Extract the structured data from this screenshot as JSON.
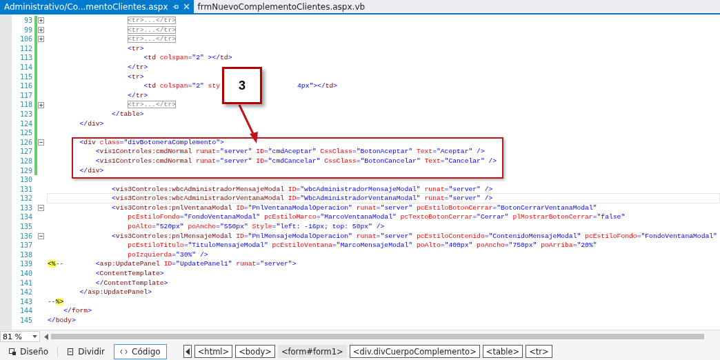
{
  "tabs": [
    {
      "label": "Administrativo/Co...mentoClientes.aspx",
      "selected": true
    },
    {
      "label": "frmNuevoComplementoClientes.aspx.vb",
      "selected": false
    }
  ],
  "callout": {
    "label": "3"
  },
  "lines": [
    {
      "num": "93",
      "changed": true,
      "current": false,
      "expanded": false,
      "tokens": [
        {
          "kind": "collapsed",
          "text": "                    <tr>...</tr>"
        }
      ]
    },
    {
      "num": "99",
      "changed": true,
      "current": false,
      "expanded": false,
      "tokens": [
        {
          "kind": "collapsed",
          "text": "                    <tr>...</tr>"
        }
      ]
    },
    {
      "num": "106",
      "changed": true,
      "current": false,
      "expanded": false,
      "tokens": [
        {
          "kind": "collapsed",
          "text": "                    <tr>...</tr>"
        }
      ]
    },
    {
      "num": "112",
      "changed": true,
      "current": false,
      "tokens": [
        {
          "kind": "delim",
          "text": "                    <"
        },
        {
          "kind": "element",
          "text": "tr"
        },
        {
          "kind": "delim",
          "text": ">"
        }
      ]
    },
    {
      "num": "113",
      "changed": true,
      "current": false,
      "tokens": [
        {
          "kind": "delim",
          "text": "                        <"
        },
        {
          "kind": "element",
          "text": "td"
        },
        {
          "kind": "attr",
          "text": " colspan"
        },
        {
          "kind": "value",
          "text": "=\"2\""
        },
        {
          "kind": "delim",
          "text": " ></"
        },
        {
          "kind": "element",
          "text": "td"
        },
        {
          "kind": "delim",
          "text": ">"
        }
      ]
    },
    {
      "num": "114",
      "changed": true,
      "current": false,
      "tokens": [
        {
          "kind": "delim",
          "text": "                    </"
        },
        {
          "kind": "element",
          "text": "tr"
        },
        {
          "kind": "delim",
          "text": ">"
        }
      ]
    },
    {
      "num": "115",
      "changed": true,
      "current": false,
      "tokens": [
        {
          "kind": "delim",
          "text": "                    <"
        },
        {
          "kind": "element",
          "text": "tr"
        },
        {
          "kind": "delim",
          "text": ">"
        }
      ]
    },
    {
      "num": "116",
      "changed": true,
      "current": false,
      "tokens": [
        {
          "kind": "delim",
          "text": "                        <"
        },
        {
          "kind": "element",
          "text": "td"
        },
        {
          "kind": "attr",
          "text": " colspan"
        },
        {
          "kind": "value",
          "text": "=\"2\""
        },
        {
          "kind": "attr",
          "text": " sty"
        }
      ],
      "after_callout": [
        {
          "kind": "value",
          "text": "4px\""
        },
        {
          "kind": "delim",
          "text": "></"
        },
        {
          "kind": "element",
          "text": "td"
        },
        {
          "kind": "delim",
          "text": ">"
        }
      ]
    },
    {
      "num": "117",
      "changed": true,
      "current": false,
      "tokens": [
        {
          "kind": "delim",
          "text": "                    </"
        },
        {
          "kind": "element",
          "text": "tr"
        },
        {
          "kind": "delim",
          "text": ">"
        }
      ]
    },
    {
      "num": "118",
      "changed": true,
      "current": false,
      "expanded": false,
      "tokens": [
        {
          "kind": "collapsed",
          "text": "                    <tr>...</tr>"
        }
      ]
    },
    {
      "num": "123",
      "changed": true,
      "current": false,
      "tokens": [
        {
          "kind": "delim",
          "text": "                </"
        },
        {
          "kind": "element",
          "text": "table"
        },
        {
          "kind": "delim",
          "text": ">"
        }
      ]
    },
    {
      "num": "124",
      "changed": true,
      "current": false,
      "tokens": [
        {
          "kind": "delim",
          "text": "        </"
        },
        {
          "kind": "element",
          "text": "div"
        },
        {
          "kind": "delim",
          "text": ">"
        }
      ]
    },
    {
      "num": "125",
      "changed": true,
      "current": false
    },
    {
      "num": "126",
      "changed": true,
      "current": false,
      "expanded": true,
      "tokens": [
        {
          "kind": "delim",
          "text": "        <"
        },
        {
          "kind": "element",
          "text": "div"
        },
        {
          "kind": "attr",
          "text": " class"
        },
        {
          "kind": "value",
          "text": "=\"divBotoneraComplemento\">"
        }
      ]
    },
    {
      "num": "127",
      "changed": true,
      "current": false,
      "tokens": [
        {
          "kind": "delim",
          "text": "            <"
        },
        {
          "kind": "element",
          "text": "vis1Controles:cmdNormal"
        },
        {
          "kind": "attr",
          "text": " runat"
        },
        {
          "kind": "value",
          "text": "=\"server\""
        },
        {
          "kind": "attr",
          "text": " ID"
        },
        {
          "kind": "value",
          "text": "=\"cmdAceptar\""
        },
        {
          "kind": "attr",
          "text": " CssClass"
        },
        {
          "kind": "value",
          "text": "=\"BotonAceptar\""
        },
        {
          "kind": "attr",
          "text": " Text"
        },
        {
          "kind": "value",
          "text": "=\"Aceptar\" />"
        }
      ]
    },
    {
      "num": "128",
      "changed": true,
      "current": false,
      "tokens": [
        {
          "kind": "delim",
          "text": "            <"
        },
        {
          "kind": "element",
          "text": "vis1Controles:cmdNormal"
        },
        {
          "kind": "attr",
          "text": " runat"
        },
        {
          "kind": "value",
          "text": "=\"server\""
        },
        {
          "kind": "attr",
          "text": " ID"
        },
        {
          "kind": "value",
          "text": "=\"cmdCancelar\""
        },
        {
          "kind": "attr",
          "text": " CssClass"
        },
        {
          "kind": "value",
          "text": "=\"BotonCancelar\""
        },
        {
          "kind": "attr",
          "text": " Text"
        },
        {
          "kind": "value",
          "text": "=\"Cancelar\" />"
        }
      ]
    },
    {
      "num": "129",
      "changed": true,
      "current": false,
      "tokens": [
        {
          "kind": "delim",
          "text": "        </"
        },
        {
          "kind": "element",
          "text": "div"
        },
        {
          "kind": "delim",
          "text": ">"
        }
      ]
    },
    {
      "num": "130",
      "changed": false,
      "current": false
    },
    {
      "num": "131",
      "changed": false,
      "current": false,
      "tokens": [
        {
          "kind": "delim",
          "text": "                <"
        },
        {
          "kind": "element",
          "text": "vis3Controles:wbcAdministradorMensajeModal"
        },
        {
          "kind": "attr",
          "text": " ID"
        },
        {
          "kind": "value",
          "text": "=\"wbcAdministradorMensajeModal\""
        },
        {
          "kind": "attr",
          "text": " runat"
        },
        {
          "kind": "value",
          "text": "=\"server\" />"
        }
      ]
    },
    {
      "num": "132",
      "changed": false,
      "current": true,
      "tokens": [
        {
          "kind": "delim",
          "text": "                <"
        },
        {
          "kind": "element",
          "text": "vis3Controles:wbcAdministradorVentanaModal"
        },
        {
          "kind": "attr",
          "text": " ID"
        },
        {
          "kind": "value",
          "text": "=\"WbcAdministradorVentanaModal\""
        },
        {
          "kind": "attr",
          "text": " runat"
        },
        {
          "kind": "value",
          "text": "=\"server\" />"
        }
      ]
    },
    {
      "num": "133",
      "changed": false,
      "current": false,
      "expanded": true,
      "tokens": [
        {
          "kind": "delim",
          "text": "                <"
        },
        {
          "kind": "element",
          "text": "vis3Controles:pnlVentanaModal"
        },
        {
          "kind": "attr",
          "text": " ID"
        },
        {
          "kind": "value",
          "text": "=\"PnlVentanaModalOperacion\""
        },
        {
          "kind": "attr",
          "text": " runat"
        },
        {
          "kind": "value",
          "text": "=\"server\""
        },
        {
          "kind": "attr",
          "text": " pcEstiloBotonCerrar"
        },
        {
          "kind": "value",
          "text": "=\"BotonCerrarVentanaModal\""
        }
      ]
    },
    {
      "num": "134",
      "changed": false,
      "current": false,
      "tokens": [
        {
          "kind": "attr",
          "text": "                    pcEstiloFondo"
        },
        {
          "kind": "value",
          "text": "=\"FondoVentanaModal\""
        },
        {
          "kind": "attr",
          "text": " pcEstiloMarco"
        },
        {
          "kind": "value",
          "text": "=\"MarcoVentanaModal\""
        },
        {
          "kind": "attr",
          "text": " pcTextoBotonCerrar"
        },
        {
          "kind": "value",
          "text": "=\"Cerrar\""
        },
        {
          "kind": "attr",
          "text": " plMostrarBotonCerrar"
        },
        {
          "kind": "value",
          "text": "=\"false\""
        }
      ]
    },
    {
      "num": "135",
      "changed": false,
      "current": false,
      "tokens": [
        {
          "kind": "attr",
          "text": "                    poAlto"
        },
        {
          "kind": "value",
          "text": "=\"520px\""
        },
        {
          "kind": "attr",
          "text": " poAncho"
        },
        {
          "kind": "value",
          "text": "=\"550px\""
        },
        {
          "kind": "attr",
          "text": " Style"
        },
        {
          "kind": "value",
          "text": "=\"left: -16px; top: 50px\" />"
        }
      ]
    },
    {
      "num": "136",
      "changed": false,
      "current": false,
      "expanded": true,
      "tokens": [
        {
          "kind": "delim",
          "text": "                <"
        },
        {
          "kind": "element",
          "text": "vis3Controles:pnlMensajeModal"
        },
        {
          "kind": "attr",
          "text": " ID"
        },
        {
          "kind": "value",
          "text": "=\"PnlMensajeModalOperacion\""
        },
        {
          "kind": "attr",
          "text": " runat"
        },
        {
          "kind": "value",
          "text": "=\"server\""
        },
        {
          "kind": "attr",
          "text": " pcEstiloContenido"
        },
        {
          "kind": "value",
          "text": "=\"ContenidoMensajeModal\""
        },
        {
          "kind": "attr",
          "text": " pcEstiloFondo"
        },
        {
          "kind": "value",
          "text": "=\"FondoVentanaModal\""
        }
      ]
    },
    {
      "num": "137",
      "changed": false,
      "current": false,
      "tokens": [
        {
          "kind": "attr",
          "text": "                    pcEstiloTitulo"
        },
        {
          "kind": "value",
          "text": "=\"TituloMensajeModal\""
        },
        {
          "kind": "attr",
          "text": " pcEstiloVentana"
        },
        {
          "kind": "value",
          "text": "=\"MarcoMensajeModal\""
        },
        {
          "kind": "attr",
          "text": " poAlto"
        },
        {
          "kind": "value",
          "text": "=\"400px\""
        },
        {
          "kind": "attr",
          "text": " poAncho"
        },
        {
          "kind": "value",
          "text": "=\"750px\""
        },
        {
          "kind": "attr",
          "text": " poArriba"
        },
        {
          "kind": "value",
          "text": "=\"20%\""
        }
      ]
    },
    {
      "num": "138",
      "changed": false,
      "current": false,
      "tokens": [
        {
          "kind": "attr",
          "text": "                    poIzquierda"
        },
        {
          "kind": "value",
          "text": "=\"30%\" />"
        }
      ]
    },
    {
      "num": "139",
      "changed": false,
      "current": false,
      "tokens": [
        {
          "kind": "server",
          "text": "<%"
        },
        {
          "kind": "comment",
          "text": "--"
        },
        {
          "kind": "delim",
          "text": "        <"
        },
        {
          "kind": "element",
          "text": "asp:UpdatePanel"
        },
        {
          "kind": "attr",
          "text": " ID"
        },
        {
          "kind": "value",
          "text": "=\"UpdatePanel1\""
        },
        {
          "kind": "attr",
          "text": " runat"
        },
        {
          "kind": "value",
          "text": "=\"server\">"
        }
      ]
    },
    {
      "num": "140",
      "changed": false,
      "current": false,
      "tokens": [
        {
          "kind": "delim",
          "text": "            <"
        },
        {
          "kind": "element",
          "text": "ContentTemplate"
        },
        {
          "kind": "delim",
          "text": ">"
        }
      ]
    },
    {
      "num": "141",
      "changed": false,
      "current": false,
      "tokens": [
        {
          "kind": "delim",
          "text": "            </"
        },
        {
          "kind": "element",
          "text": "ContentTemplate"
        },
        {
          "kind": "delim",
          "text": ">"
        }
      ]
    },
    {
      "num": "142",
      "changed": false,
      "current": false,
      "tokens": [
        {
          "kind": "delim",
          "text": "        </"
        },
        {
          "kind": "element",
          "text": "asp:UpdatePanel"
        },
        {
          "kind": "delim",
          "text": ">"
        }
      ]
    },
    {
      "num": "143",
      "changed": false,
      "current": false,
      "tokens": [
        {
          "kind": "comment",
          "text": "--"
        },
        {
          "kind": "server",
          "text": "%>"
        }
      ]
    },
    {
      "num": "144",
      "changed": false,
      "current": false,
      "tokens": [
        {
          "kind": "delim",
          "text": "    </"
        },
        {
          "kind": "element",
          "text": "form"
        },
        {
          "kind": "delim",
          "text": ">"
        }
      ]
    },
    {
      "num": "145",
      "changed": false,
      "current": false,
      "tokens": [
        {
          "kind": "delim",
          "text": "</"
        },
        {
          "kind": "element",
          "text": "body"
        },
        {
          "kind": "delim",
          "text": ">"
        }
      ]
    }
  ],
  "zoom": {
    "value": "81 %"
  },
  "views": [
    {
      "kind": "design",
      "label": "Diseño",
      "selected": false
    },
    {
      "kind": "split",
      "label": "Dividir",
      "selected": false
    },
    {
      "kind": "code",
      "label": "Código",
      "selected": true
    }
  ],
  "breadcrumbs": [
    {
      "label": "<html>",
      "selected": false
    },
    {
      "label": "<body>",
      "selected": false
    },
    {
      "label": "<form#form1>",
      "selected": true
    },
    {
      "label": "<div.divCuerpoComplemento>",
      "selected": false
    },
    {
      "label": "<table>",
      "selected": false
    },
    {
      "label": "<tr>",
      "selected": false
    }
  ]
}
